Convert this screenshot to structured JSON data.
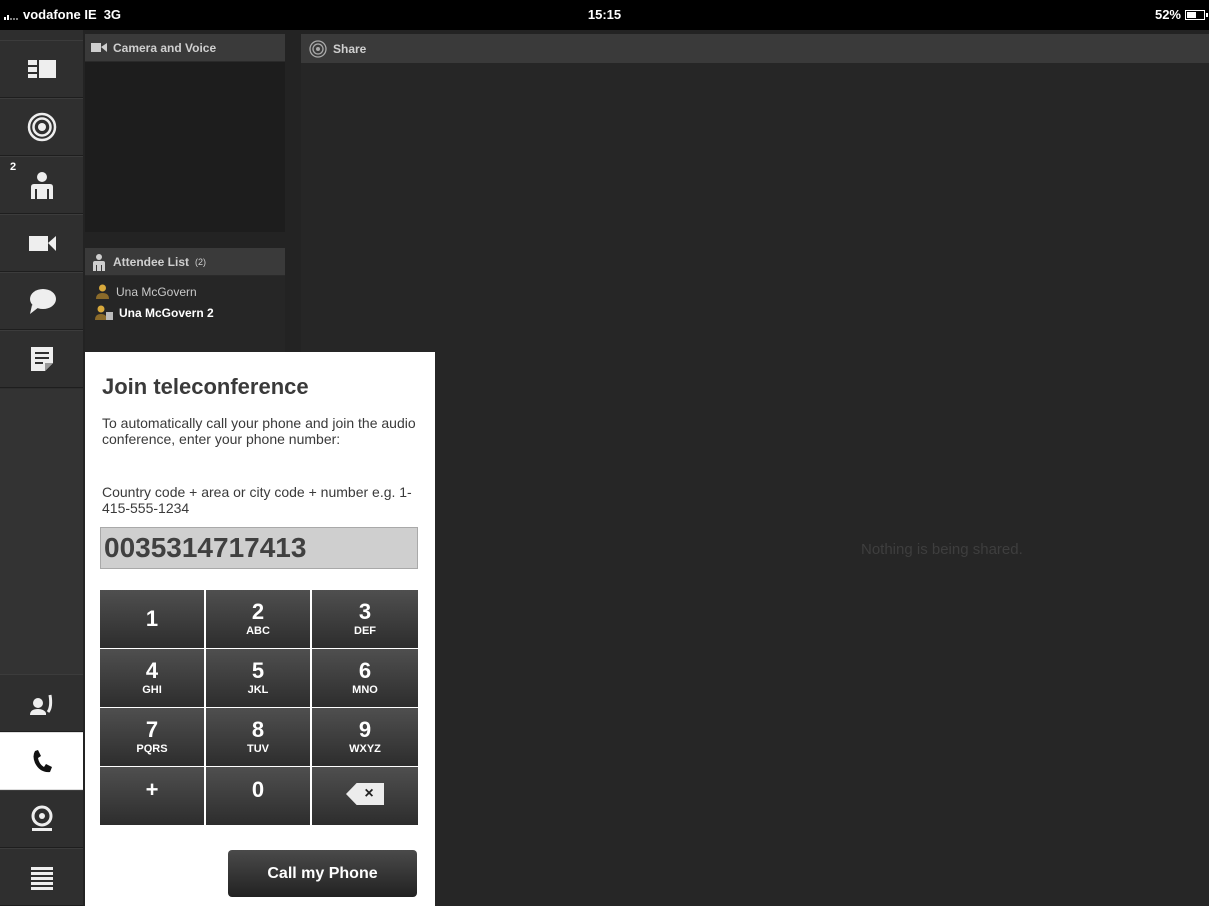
{
  "status_bar": {
    "carrier": "vodafone IE",
    "network": "3G",
    "time": "15:15",
    "battery": "52%"
  },
  "sidebar": {
    "items": [
      {
        "id": "layout",
        "icon": "layout-icon",
        "active": false
      },
      {
        "id": "share",
        "icon": "share-target-icon",
        "active": false
      },
      {
        "id": "attendees",
        "icon": "attendee-icon",
        "badge": "2",
        "active": false
      },
      {
        "id": "video",
        "icon": "video-camera-icon",
        "active": false
      },
      {
        "id": "chat",
        "icon": "chat-bubble-icon",
        "active": false
      },
      {
        "id": "notes",
        "icon": "notes-icon",
        "active": false
      },
      {
        "id": "raise-hand",
        "icon": "raise-hand-icon",
        "active": false
      },
      {
        "id": "phone",
        "icon": "phone-icon",
        "active": true
      },
      {
        "id": "webcam",
        "icon": "webcam-icon",
        "active": false
      },
      {
        "id": "menu",
        "icon": "menu-icon",
        "active": false
      }
    ]
  },
  "camera_panel": {
    "title": "Camera and Voice"
  },
  "attendee_panel": {
    "title": "Attendee List",
    "count": "(2)",
    "attendees": [
      {
        "name": "Una McGovern",
        "bold": false
      },
      {
        "name": "Una McGovern 2",
        "bold": true
      }
    ]
  },
  "share_panel": {
    "title": "Share",
    "empty_message": "Nothing is being shared."
  },
  "dialog": {
    "title": "Join teleconference",
    "instructions": "To automatically call your phone and join the audio conference, enter your phone number:",
    "format_hint": "Country code + area or city code + number e.g. 1-415-555-1234",
    "phone_value": "0035314717413",
    "keys": [
      {
        "num": "1",
        "letters": ""
      },
      {
        "num": "2",
        "letters": "ABC"
      },
      {
        "num": "3",
        "letters": "DEF"
      },
      {
        "num": "4",
        "letters": "GHI"
      },
      {
        "num": "5",
        "letters": "JKL"
      },
      {
        "num": "6",
        "letters": "MNO"
      },
      {
        "num": "7",
        "letters": "PQRS"
      },
      {
        "num": "8",
        "letters": "TUV"
      },
      {
        "num": "9",
        "letters": "WXYZ"
      },
      {
        "num": "+",
        "letters": ""
      },
      {
        "num": "0",
        "letters": ""
      },
      {
        "num": "×",
        "letters": ""
      }
    ],
    "call_button": "Call my Phone"
  }
}
